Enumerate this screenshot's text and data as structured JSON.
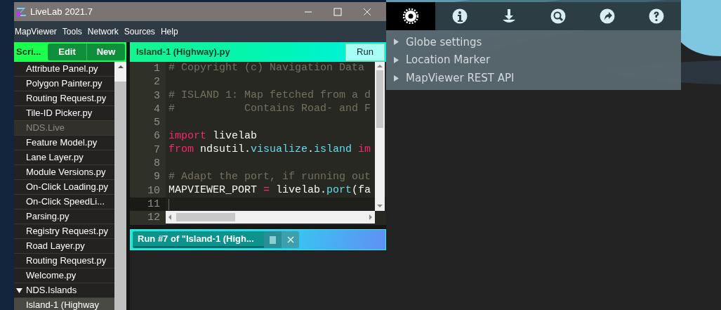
{
  "window": {
    "title": "LiveLab 2021.7"
  },
  "menu": [
    "MapViewer",
    "Tools",
    "Network",
    "Sources",
    "Help"
  ],
  "sidebar": {
    "title": "Scri...",
    "buttons": [
      "Edit",
      "New"
    ],
    "items": [
      {
        "label": "Attribute Panel.py",
        "kind": "file",
        "selected": false
      },
      {
        "label": "Polygon Painter.py",
        "kind": "file",
        "selected": false
      },
      {
        "label": "Routing Request.py",
        "kind": "file",
        "selected": false
      },
      {
        "label": "Tile-ID Picker.py",
        "kind": "file",
        "selected": false
      },
      {
        "label": "NDS.Live",
        "kind": "header",
        "children": [
          {
            "label": "Feature Model.py",
            "kind": "file",
            "selected": false
          },
          {
            "label": "Lane Layer.py",
            "kind": "file",
            "selected": false
          },
          {
            "label": "Module Versions.py",
            "kind": "file",
            "selected": false
          },
          {
            "label": "On-Click Loading.py",
            "kind": "file",
            "selected": false
          },
          {
            "label": "On-Click SpeedLi...",
            "kind": "file",
            "selected": false
          },
          {
            "label": "Parsing.py",
            "kind": "file",
            "selected": false
          },
          {
            "label": "Registry Request.py",
            "kind": "file",
            "selected": false
          },
          {
            "label": "Road Layer.py",
            "kind": "file",
            "selected": false
          },
          {
            "label": "Routing Request.py",
            "kind": "file",
            "selected": false
          },
          {
            "label": "Welcome.py",
            "kind": "file",
            "selected": false
          }
        ]
      },
      {
        "label": "NDS.Islands",
        "kind": "folder",
        "expanded": true,
        "children": [
          {
            "label": "Island-1 (Highway",
            "kind": "file",
            "selected": true
          }
        ]
      }
    ]
  },
  "editor": {
    "tab": "Island-1 (Highway).py",
    "run_button": "Run",
    "lines": [
      {
        "number": "1",
        "current": false,
        "tokens": [
          {
            "kind": "comment",
            "text": "# Copyright (c) Navigation Data "
          }
        ]
      },
      {
        "number": "2",
        "current": false
      },
      {
        "number": "3",
        "current": false,
        "tokens": [
          {
            "kind": "comment",
            "text": "# ISLAND 1: Map fetched from a d"
          }
        ]
      },
      {
        "number": "4",
        "current": false,
        "tokens": [
          {
            "kind": "comment",
            "text": "#           Contains Road- and F"
          }
        ]
      },
      {
        "number": "5",
        "current": false
      },
      {
        "number": "6",
        "current": false,
        "tokens": [
          {
            "kind": "keyword",
            "text": "import"
          },
          {
            "kind": "plain",
            "text": " livelab"
          }
        ]
      },
      {
        "number": "7",
        "current": false,
        "tokens": [
          {
            "kind": "keyword",
            "text": "from"
          },
          {
            "kind": "plain",
            "text": " ndsutil."
          },
          {
            "kind": "attr",
            "text": "visualize"
          },
          {
            "kind": "plain",
            "text": "."
          },
          {
            "kind": "attr",
            "text": "island"
          },
          {
            "kind": "keyword",
            "text": " im"
          }
        ]
      },
      {
        "number": "8",
        "current": false
      },
      {
        "number": "9",
        "current": false,
        "tokens": [
          {
            "kind": "comment",
            "text": "# Adapt the port, if running out"
          }
        ]
      },
      {
        "number": "10",
        "current": false,
        "tokens": [
          {
            "kind": "plain",
            "text": "MAPVIEWER_PORT "
          },
          {
            "kind": "operator",
            "text": "="
          },
          {
            "kind": "plain",
            "text": " livelab."
          },
          {
            "kind": "attr",
            "text": "port"
          },
          {
            "kind": "plain",
            "text": "(fa"
          }
        ]
      },
      {
        "number": "11",
        "current": true
      },
      {
        "number": "12",
        "current": false
      }
    ]
  },
  "run_panel": {
    "tab": "Run #7 of \"Island-1 (High..."
  },
  "map_toolbar": [
    {
      "kind": "gear",
      "selected": true
    },
    {
      "kind": "info",
      "selected": false
    },
    {
      "kind": "download",
      "selected": false
    },
    {
      "kind": "search",
      "selected": false
    },
    {
      "kind": "share",
      "selected": false
    },
    {
      "kind": "help",
      "selected": false
    }
  ],
  "map_panel": {
    "items": [
      {
        "label": "Globe settings",
        "expanded": false
      },
      {
        "label": "Location Marker",
        "expanded": false
      },
      {
        "label": "MapViewer REST API",
        "expanded": false
      }
    ]
  }
}
